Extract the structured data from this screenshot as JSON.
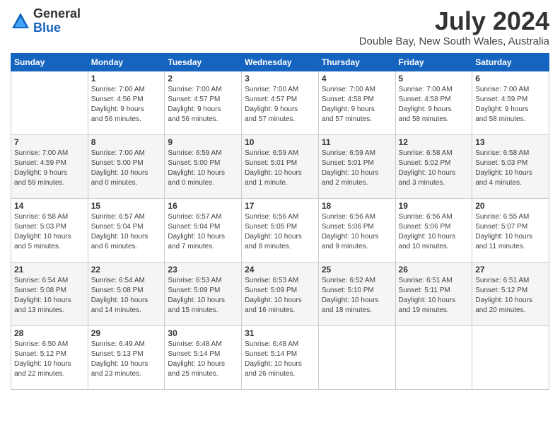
{
  "header": {
    "logo_general": "General",
    "logo_blue": "Blue",
    "month_title": "July 2024",
    "location": "Double Bay, New South Wales, Australia"
  },
  "calendar": {
    "days_of_week": [
      "Sunday",
      "Monday",
      "Tuesday",
      "Wednesday",
      "Thursday",
      "Friday",
      "Saturday"
    ],
    "weeks": [
      [
        {
          "day": "",
          "info": ""
        },
        {
          "day": "1",
          "info": "Sunrise: 7:00 AM\nSunset: 4:56 PM\nDaylight: 9 hours\nand 56 minutes."
        },
        {
          "day": "2",
          "info": "Sunrise: 7:00 AM\nSunset: 4:57 PM\nDaylight: 9 hours\nand 56 minutes."
        },
        {
          "day": "3",
          "info": "Sunrise: 7:00 AM\nSunset: 4:57 PM\nDaylight: 9 hours\nand 57 minutes."
        },
        {
          "day": "4",
          "info": "Sunrise: 7:00 AM\nSunset: 4:58 PM\nDaylight: 9 hours\nand 57 minutes."
        },
        {
          "day": "5",
          "info": "Sunrise: 7:00 AM\nSunset: 4:58 PM\nDaylight: 9 hours\nand 58 minutes."
        },
        {
          "day": "6",
          "info": "Sunrise: 7:00 AM\nSunset: 4:59 PM\nDaylight: 9 hours\nand 58 minutes."
        }
      ],
      [
        {
          "day": "7",
          "info": "Sunrise: 7:00 AM\nSunset: 4:59 PM\nDaylight: 9 hours\nand 59 minutes."
        },
        {
          "day": "8",
          "info": "Sunrise: 7:00 AM\nSunset: 5:00 PM\nDaylight: 10 hours\nand 0 minutes."
        },
        {
          "day": "9",
          "info": "Sunrise: 6:59 AM\nSunset: 5:00 PM\nDaylight: 10 hours\nand 0 minutes."
        },
        {
          "day": "10",
          "info": "Sunrise: 6:59 AM\nSunset: 5:01 PM\nDaylight: 10 hours\nand 1 minute."
        },
        {
          "day": "11",
          "info": "Sunrise: 6:59 AM\nSunset: 5:01 PM\nDaylight: 10 hours\nand 2 minutes."
        },
        {
          "day": "12",
          "info": "Sunrise: 6:58 AM\nSunset: 5:02 PM\nDaylight: 10 hours\nand 3 minutes."
        },
        {
          "day": "13",
          "info": "Sunrise: 6:58 AM\nSunset: 5:03 PM\nDaylight: 10 hours\nand 4 minutes."
        }
      ],
      [
        {
          "day": "14",
          "info": "Sunrise: 6:58 AM\nSunset: 5:03 PM\nDaylight: 10 hours\nand 5 minutes."
        },
        {
          "day": "15",
          "info": "Sunrise: 6:57 AM\nSunset: 5:04 PM\nDaylight: 10 hours\nand 6 minutes."
        },
        {
          "day": "16",
          "info": "Sunrise: 6:57 AM\nSunset: 5:04 PM\nDaylight: 10 hours\nand 7 minutes."
        },
        {
          "day": "17",
          "info": "Sunrise: 6:56 AM\nSunset: 5:05 PM\nDaylight: 10 hours\nand 8 minutes."
        },
        {
          "day": "18",
          "info": "Sunrise: 6:56 AM\nSunset: 5:06 PM\nDaylight: 10 hours\nand 9 minutes."
        },
        {
          "day": "19",
          "info": "Sunrise: 6:56 AM\nSunset: 5:06 PM\nDaylight: 10 hours\nand 10 minutes."
        },
        {
          "day": "20",
          "info": "Sunrise: 6:55 AM\nSunset: 5:07 PM\nDaylight: 10 hours\nand 11 minutes."
        }
      ],
      [
        {
          "day": "21",
          "info": "Sunrise: 6:54 AM\nSunset: 5:08 PM\nDaylight: 10 hours\nand 13 minutes."
        },
        {
          "day": "22",
          "info": "Sunrise: 6:54 AM\nSunset: 5:08 PM\nDaylight: 10 hours\nand 14 minutes."
        },
        {
          "day": "23",
          "info": "Sunrise: 6:53 AM\nSunset: 5:09 PM\nDaylight: 10 hours\nand 15 minutes."
        },
        {
          "day": "24",
          "info": "Sunrise: 6:53 AM\nSunset: 5:09 PM\nDaylight: 10 hours\nand 16 minutes."
        },
        {
          "day": "25",
          "info": "Sunrise: 6:52 AM\nSunset: 5:10 PM\nDaylight: 10 hours\nand 18 minutes."
        },
        {
          "day": "26",
          "info": "Sunrise: 6:51 AM\nSunset: 5:11 PM\nDaylight: 10 hours\nand 19 minutes."
        },
        {
          "day": "27",
          "info": "Sunrise: 6:51 AM\nSunset: 5:12 PM\nDaylight: 10 hours\nand 20 minutes."
        }
      ],
      [
        {
          "day": "28",
          "info": "Sunrise: 6:50 AM\nSunset: 5:12 PM\nDaylight: 10 hours\nand 22 minutes."
        },
        {
          "day": "29",
          "info": "Sunrise: 6:49 AM\nSunset: 5:13 PM\nDaylight: 10 hours\nand 23 minutes."
        },
        {
          "day": "30",
          "info": "Sunrise: 6:48 AM\nSunset: 5:14 PM\nDaylight: 10 hours\nand 25 minutes."
        },
        {
          "day": "31",
          "info": "Sunrise: 6:48 AM\nSunset: 5:14 PM\nDaylight: 10 hours\nand 26 minutes."
        },
        {
          "day": "",
          "info": ""
        },
        {
          "day": "",
          "info": ""
        },
        {
          "day": "",
          "info": ""
        }
      ]
    ]
  }
}
